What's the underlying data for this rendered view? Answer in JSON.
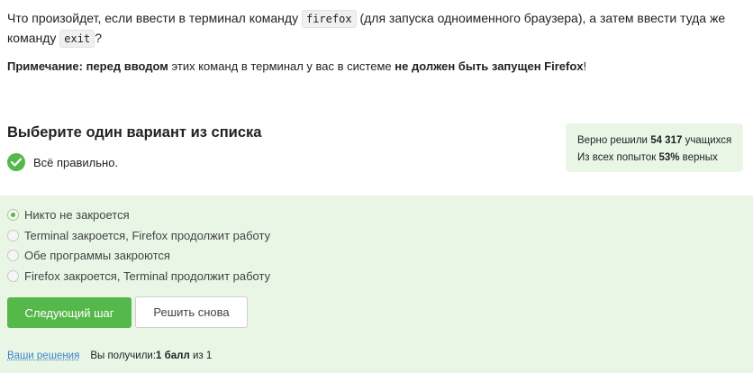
{
  "question": {
    "part1": "Что произойдет, если ввести в терминал команду ",
    "code1": "firefox",
    "part2": " (для запуска одноименного браузера), а затем ввести туда же команду ",
    "code2": "exit",
    "part3": "?"
  },
  "note": {
    "bold1": "Примечание: перед вводом",
    "text1": " этих команд в терминал у вас в системе ",
    "bold2": "не должен быть запущен Firefox",
    "text2": "!"
  },
  "section": {
    "heading": "Выберите один вариант из списка",
    "status": "Всё правильно."
  },
  "stats": {
    "solved_prefix": "Верно решили ",
    "solved_count": "54 317",
    "solved_suffix": " учащихся",
    "attempts_prefix": "Из всех попыток ",
    "attempts_percent": "53%",
    "attempts_suffix": " верных"
  },
  "options": [
    {
      "label": "Никто не закроется",
      "selected": true
    },
    {
      "label": "Terminal закроется, Firefox продолжит работу",
      "selected": false
    },
    {
      "label": "Обе программы закроются",
      "selected": false
    },
    {
      "label": "Firefox закроется, Terminal продолжит работу",
      "selected": false
    }
  ],
  "buttons": {
    "next": "Следующий шаг",
    "retry": "Решить снова"
  },
  "footer": {
    "link": "Ваши решения",
    "score_prefix": "Вы получили: ",
    "score_value": "1 балл",
    "score_suffix": " из 1"
  },
  "colors": {
    "accent": "#55b84a",
    "answer_bg": "#e9f6e6",
    "link": "#3d86c6"
  }
}
